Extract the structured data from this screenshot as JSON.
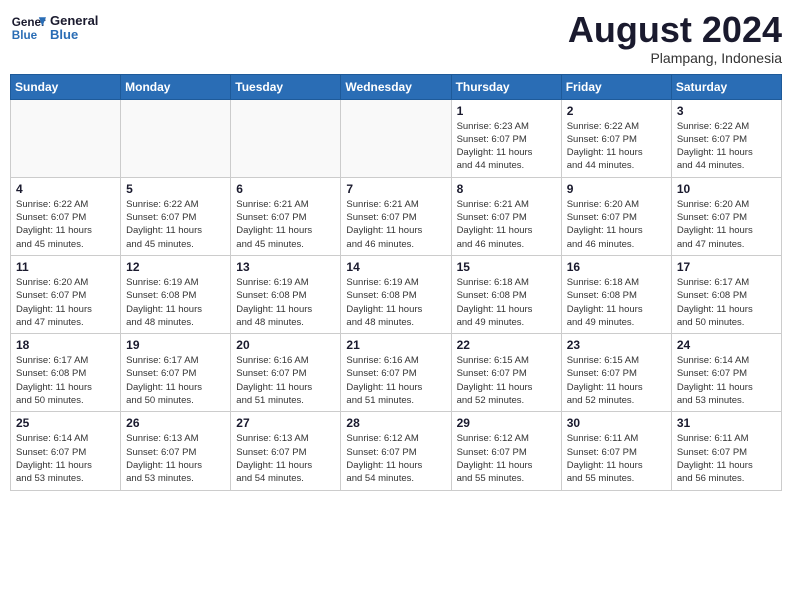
{
  "header": {
    "logo_general": "General",
    "logo_blue": "Blue",
    "month_title": "August 2024",
    "location": "Plampang, Indonesia"
  },
  "weekdays": [
    "Sunday",
    "Monday",
    "Tuesday",
    "Wednesday",
    "Thursday",
    "Friday",
    "Saturday"
  ],
  "weeks": [
    [
      {
        "day": "",
        "info": ""
      },
      {
        "day": "",
        "info": ""
      },
      {
        "day": "",
        "info": ""
      },
      {
        "day": "",
        "info": ""
      },
      {
        "day": "1",
        "info": "Sunrise: 6:23 AM\nSunset: 6:07 PM\nDaylight: 11 hours\nand 44 minutes."
      },
      {
        "day": "2",
        "info": "Sunrise: 6:22 AM\nSunset: 6:07 PM\nDaylight: 11 hours\nand 44 minutes."
      },
      {
        "day": "3",
        "info": "Sunrise: 6:22 AM\nSunset: 6:07 PM\nDaylight: 11 hours\nand 44 minutes."
      }
    ],
    [
      {
        "day": "4",
        "info": "Sunrise: 6:22 AM\nSunset: 6:07 PM\nDaylight: 11 hours\nand 45 minutes."
      },
      {
        "day": "5",
        "info": "Sunrise: 6:22 AM\nSunset: 6:07 PM\nDaylight: 11 hours\nand 45 minutes."
      },
      {
        "day": "6",
        "info": "Sunrise: 6:21 AM\nSunset: 6:07 PM\nDaylight: 11 hours\nand 45 minutes."
      },
      {
        "day": "7",
        "info": "Sunrise: 6:21 AM\nSunset: 6:07 PM\nDaylight: 11 hours\nand 46 minutes."
      },
      {
        "day": "8",
        "info": "Sunrise: 6:21 AM\nSunset: 6:07 PM\nDaylight: 11 hours\nand 46 minutes."
      },
      {
        "day": "9",
        "info": "Sunrise: 6:20 AM\nSunset: 6:07 PM\nDaylight: 11 hours\nand 46 minutes."
      },
      {
        "day": "10",
        "info": "Sunrise: 6:20 AM\nSunset: 6:07 PM\nDaylight: 11 hours\nand 47 minutes."
      }
    ],
    [
      {
        "day": "11",
        "info": "Sunrise: 6:20 AM\nSunset: 6:07 PM\nDaylight: 11 hours\nand 47 minutes."
      },
      {
        "day": "12",
        "info": "Sunrise: 6:19 AM\nSunset: 6:08 PM\nDaylight: 11 hours\nand 48 minutes."
      },
      {
        "day": "13",
        "info": "Sunrise: 6:19 AM\nSunset: 6:08 PM\nDaylight: 11 hours\nand 48 minutes."
      },
      {
        "day": "14",
        "info": "Sunrise: 6:19 AM\nSunset: 6:08 PM\nDaylight: 11 hours\nand 48 minutes."
      },
      {
        "day": "15",
        "info": "Sunrise: 6:18 AM\nSunset: 6:08 PM\nDaylight: 11 hours\nand 49 minutes."
      },
      {
        "day": "16",
        "info": "Sunrise: 6:18 AM\nSunset: 6:08 PM\nDaylight: 11 hours\nand 49 minutes."
      },
      {
        "day": "17",
        "info": "Sunrise: 6:17 AM\nSunset: 6:08 PM\nDaylight: 11 hours\nand 50 minutes."
      }
    ],
    [
      {
        "day": "18",
        "info": "Sunrise: 6:17 AM\nSunset: 6:08 PM\nDaylight: 11 hours\nand 50 minutes."
      },
      {
        "day": "19",
        "info": "Sunrise: 6:17 AM\nSunset: 6:07 PM\nDaylight: 11 hours\nand 50 minutes."
      },
      {
        "day": "20",
        "info": "Sunrise: 6:16 AM\nSunset: 6:07 PM\nDaylight: 11 hours\nand 51 minutes."
      },
      {
        "day": "21",
        "info": "Sunrise: 6:16 AM\nSunset: 6:07 PM\nDaylight: 11 hours\nand 51 minutes."
      },
      {
        "day": "22",
        "info": "Sunrise: 6:15 AM\nSunset: 6:07 PM\nDaylight: 11 hours\nand 52 minutes."
      },
      {
        "day": "23",
        "info": "Sunrise: 6:15 AM\nSunset: 6:07 PM\nDaylight: 11 hours\nand 52 minutes."
      },
      {
        "day": "24",
        "info": "Sunrise: 6:14 AM\nSunset: 6:07 PM\nDaylight: 11 hours\nand 53 minutes."
      }
    ],
    [
      {
        "day": "25",
        "info": "Sunrise: 6:14 AM\nSunset: 6:07 PM\nDaylight: 11 hours\nand 53 minutes."
      },
      {
        "day": "26",
        "info": "Sunrise: 6:13 AM\nSunset: 6:07 PM\nDaylight: 11 hours\nand 53 minutes."
      },
      {
        "day": "27",
        "info": "Sunrise: 6:13 AM\nSunset: 6:07 PM\nDaylight: 11 hours\nand 54 minutes."
      },
      {
        "day": "28",
        "info": "Sunrise: 6:12 AM\nSunset: 6:07 PM\nDaylight: 11 hours\nand 54 minutes."
      },
      {
        "day": "29",
        "info": "Sunrise: 6:12 AM\nSunset: 6:07 PM\nDaylight: 11 hours\nand 55 minutes."
      },
      {
        "day": "30",
        "info": "Sunrise: 6:11 AM\nSunset: 6:07 PM\nDaylight: 11 hours\nand 55 minutes."
      },
      {
        "day": "31",
        "info": "Sunrise: 6:11 AM\nSunset: 6:07 PM\nDaylight: 11 hours\nand 56 minutes."
      }
    ]
  ]
}
